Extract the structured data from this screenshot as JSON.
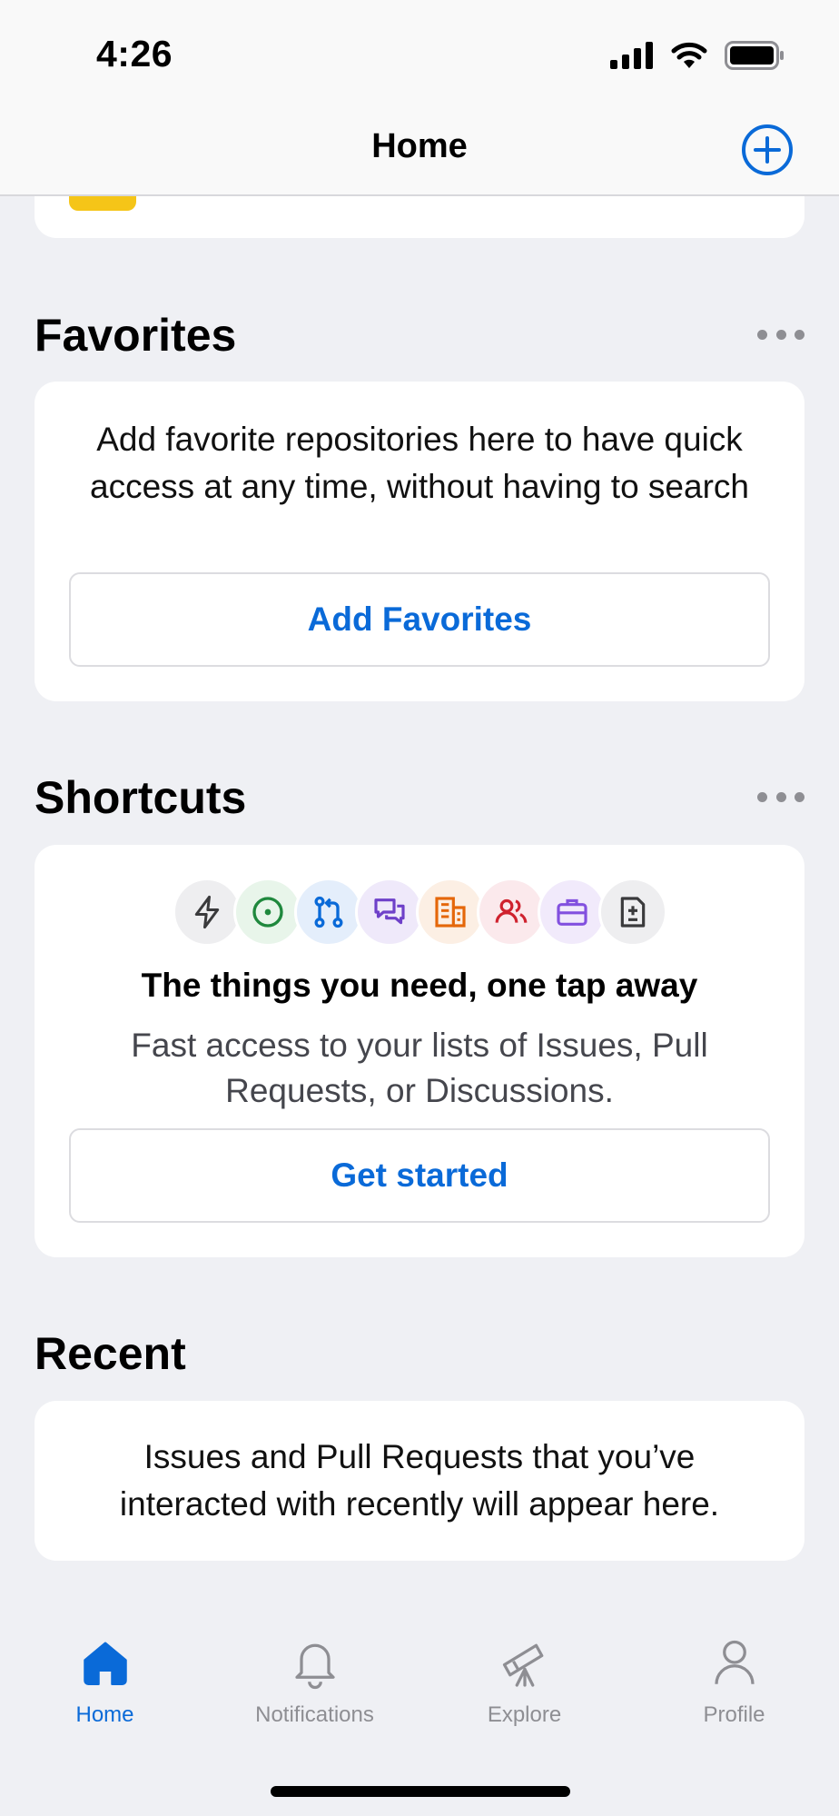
{
  "status_bar": {
    "time": "4:26"
  },
  "nav": {
    "title": "Home"
  },
  "favorites": {
    "title": "Favorites",
    "description": "Add favorite repositories here to have quick access at any time, without having to search",
    "button_label": "Add Favorites"
  },
  "shortcuts": {
    "title": "Shortcuts",
    "icons": [
      "lightning-icon",
      "issue-icon",
      "pull-request-icon",
      "discussion-icon",
      "organization-icon",
      "people-icon",
      "briefcase-icon",
      "diff-icon"
    ],
    "heading": "The things you need, one tap away",
    "description": "Fast access to your lists of Issues, Pull Requests, or Discussions.",
    "button_label": "Get started"
  },
  "recent": {
    "title": "Recent",
    "description": "Issues and Pull Requests that you’ve interacted with recently will appear here."
  },
  "tabbar": {
    "items": [
      {
        "label": "Home",
        "icon": "home-icon",
        "active": true
      },
      {
        "label": "Notifications",
        "icon": "bell-icon",
        "active": false
      },
      {
        "label": "Explore",
        "icon": "telescope-icon",
        "active": false
      },
      {
        "label": "Profile",
        "icon": "person-icon",
        "active": false
      }
    ]
  },
  "colors": {
    "accent": "#0a6ad8",
    "background": "#eff0f4",
    "inactive": "#8e8e93"
  }
}
